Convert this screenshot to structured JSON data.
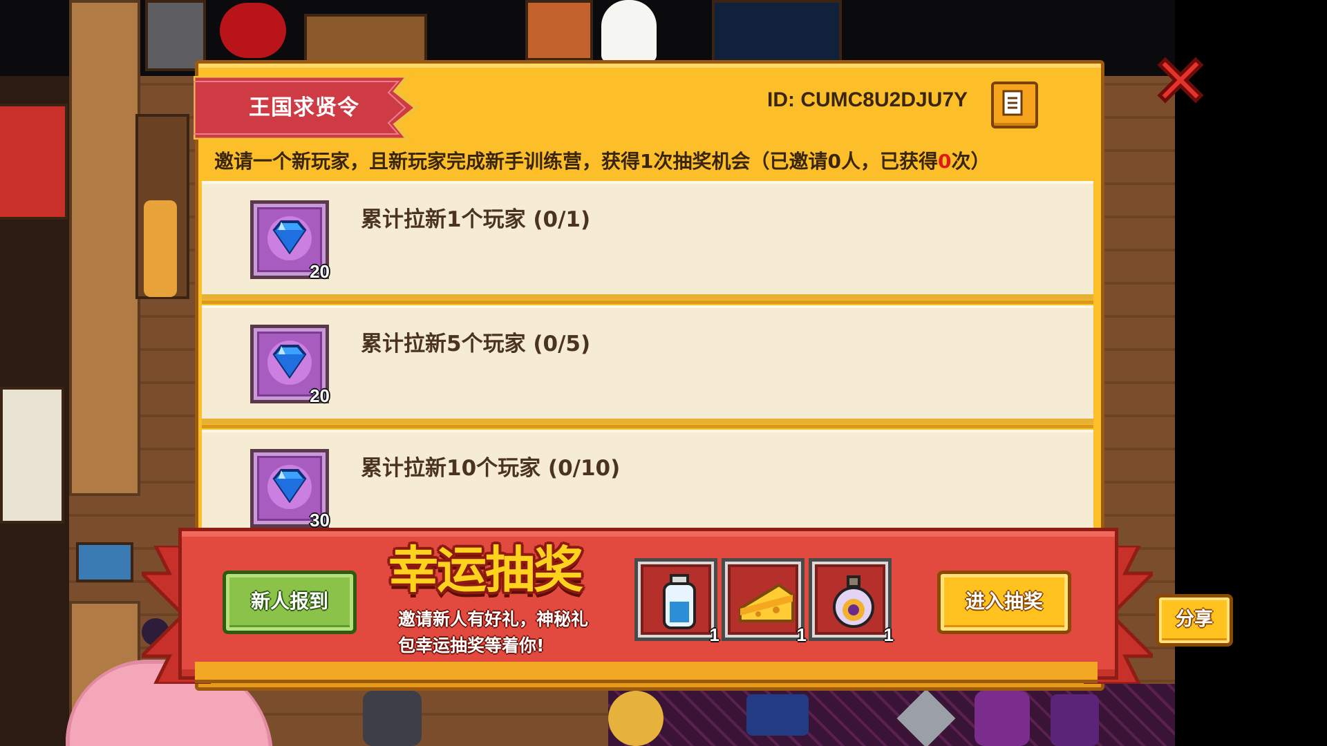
{
  "panel": {
    "title": "王国求贤令",
    "id_label": "ID: CUMC8U2DJU7Y",
    "invite_desc_prefix": "邀请一个新玩家，且新玩家完成新手训练营，获得1次抽奖机会（已邀请0人，已获得",
    "invite_desc_count": "0",
    "invite_desc_suffix": "次）"
  },
  "tasks": [
    {
      "label": "累计拉新1个玩家 (0/1)",
      "reward_icon": "purple-gem-icon",
      "reward_count": "20"
    },
    {
      "label": "累计拉新5个玩家 (0/5)",
      "reward_icon": "purple-gem-icon",
      "reward_count": "20"
    },
    {
      "label": "累计拉新10个玩家 (0/10)",
      "reward_icon": "purple-gem-icon",
      "reward_count": "30"
    }
  ],
  "lottery": {
    "checkin_label": "新人报到",
    "title": "幸运抽奖",
    "subtitle_line1": "邀请新人有好礼，神秘礼",
    "subtitle_line2": "包幸运抽奖等着你!",
    "prizes": [
      {
        "icon": "bottle-icon",
        "count": "1"
      },
      {
        "icon": "cheese-icon",
        "count": "1"
      },
      {
        "icon": "potion-icon",
        "count": "1"
      }
    ],
    "enter_label": "进入抽奖"
  },
  "share_label": "分享",
  "colors": {
    "panel_gold": "#fcbf2a",
    "banner_red": "#e34a3f",
    "highlight_red": "#e01818",
    "green_button": "#8bc34a",
    "yellow_button": "#ffc21f"
  }
}
